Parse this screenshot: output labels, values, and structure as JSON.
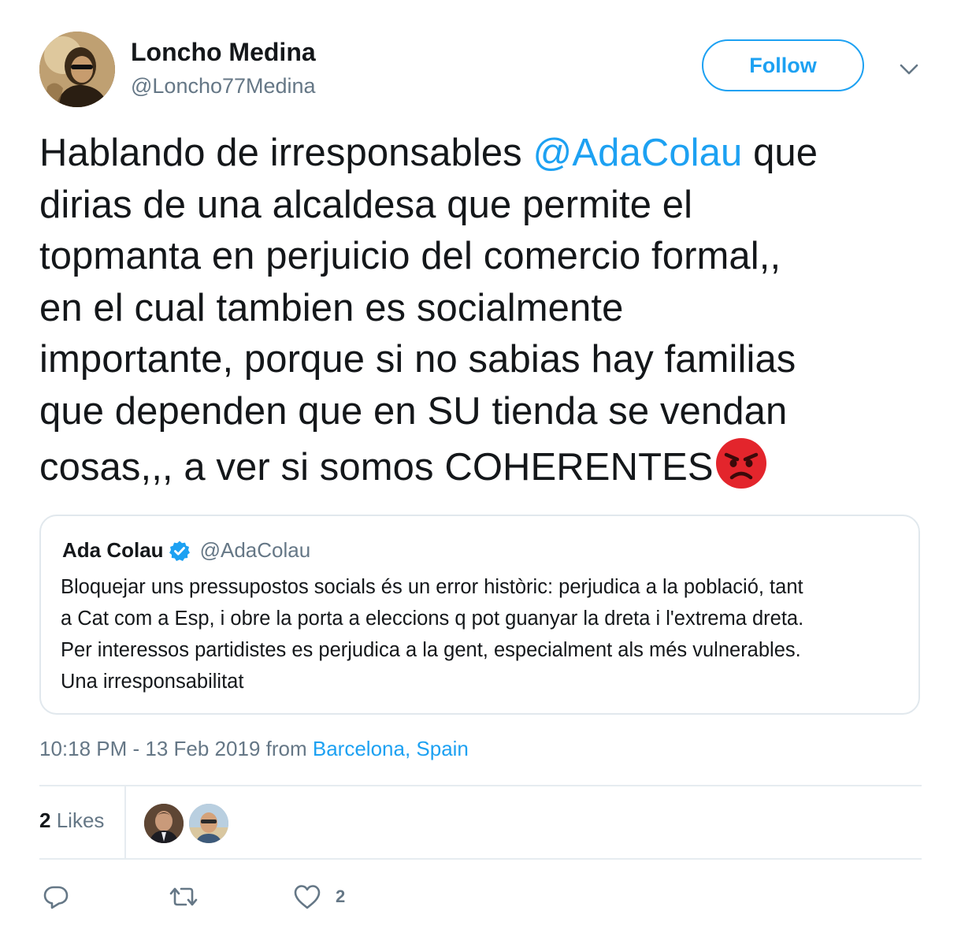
{
  "author": {
    "display_name": "Loncho Medina",
    "handle": "@Loncho77Medina"
  },
  "follow_button_label": "Follow",
  "tweet": {
    "lines": [
      {
        "before": "Hablando de irresponsables ",
        "mention": "@AdaColau",
        "after": " que"
      },
      "dirias de una alcaldesa que permite el",
      "topmanta en perjuicio del comercio formal,,",
      "en el cual tambien es socialmente",
      "importante, porque si no sabias hay familias",
      "que dependen que en SU tienda se vendan",
      "cosas,,, a ver si somos COHERENTES"
    ],
    "emoji": "angry-face-icon"
  },
  "quoted_tweet": {
    "display_name": "Ada Colau",
    "handle": "@AdaColau",
    "verified": true,
    "lines": [
      "Bloquejar uns pressupostos socials és un error històric: perjudica a la població, tant",
      "a Cat com a Esp, i obre la porta a eleccions q pot guanyar la dreta i l'extrema dreta.",
      "Per interessos partidistes es perjudica a la gent, especialment als més vulnerables.",
      "Una irresponsabilitat"
    ]
  },
  "meta": {
    "timestamp": "10:18 PM - 13 Feb 2019",
    "from_label": "from",
    "location": "Barcelona, Spain"
  },
  "stats": {
    "likes_count": "2",
    "likes_label": "Likes"
  },
  "actions": {
    "like_count": "2"
  },
  "colors": {
    "link": "#1da1f2",
    "muted": "#657786",
    "text": "#14171a",
    "border": "#e1e8ed"
  }
}
